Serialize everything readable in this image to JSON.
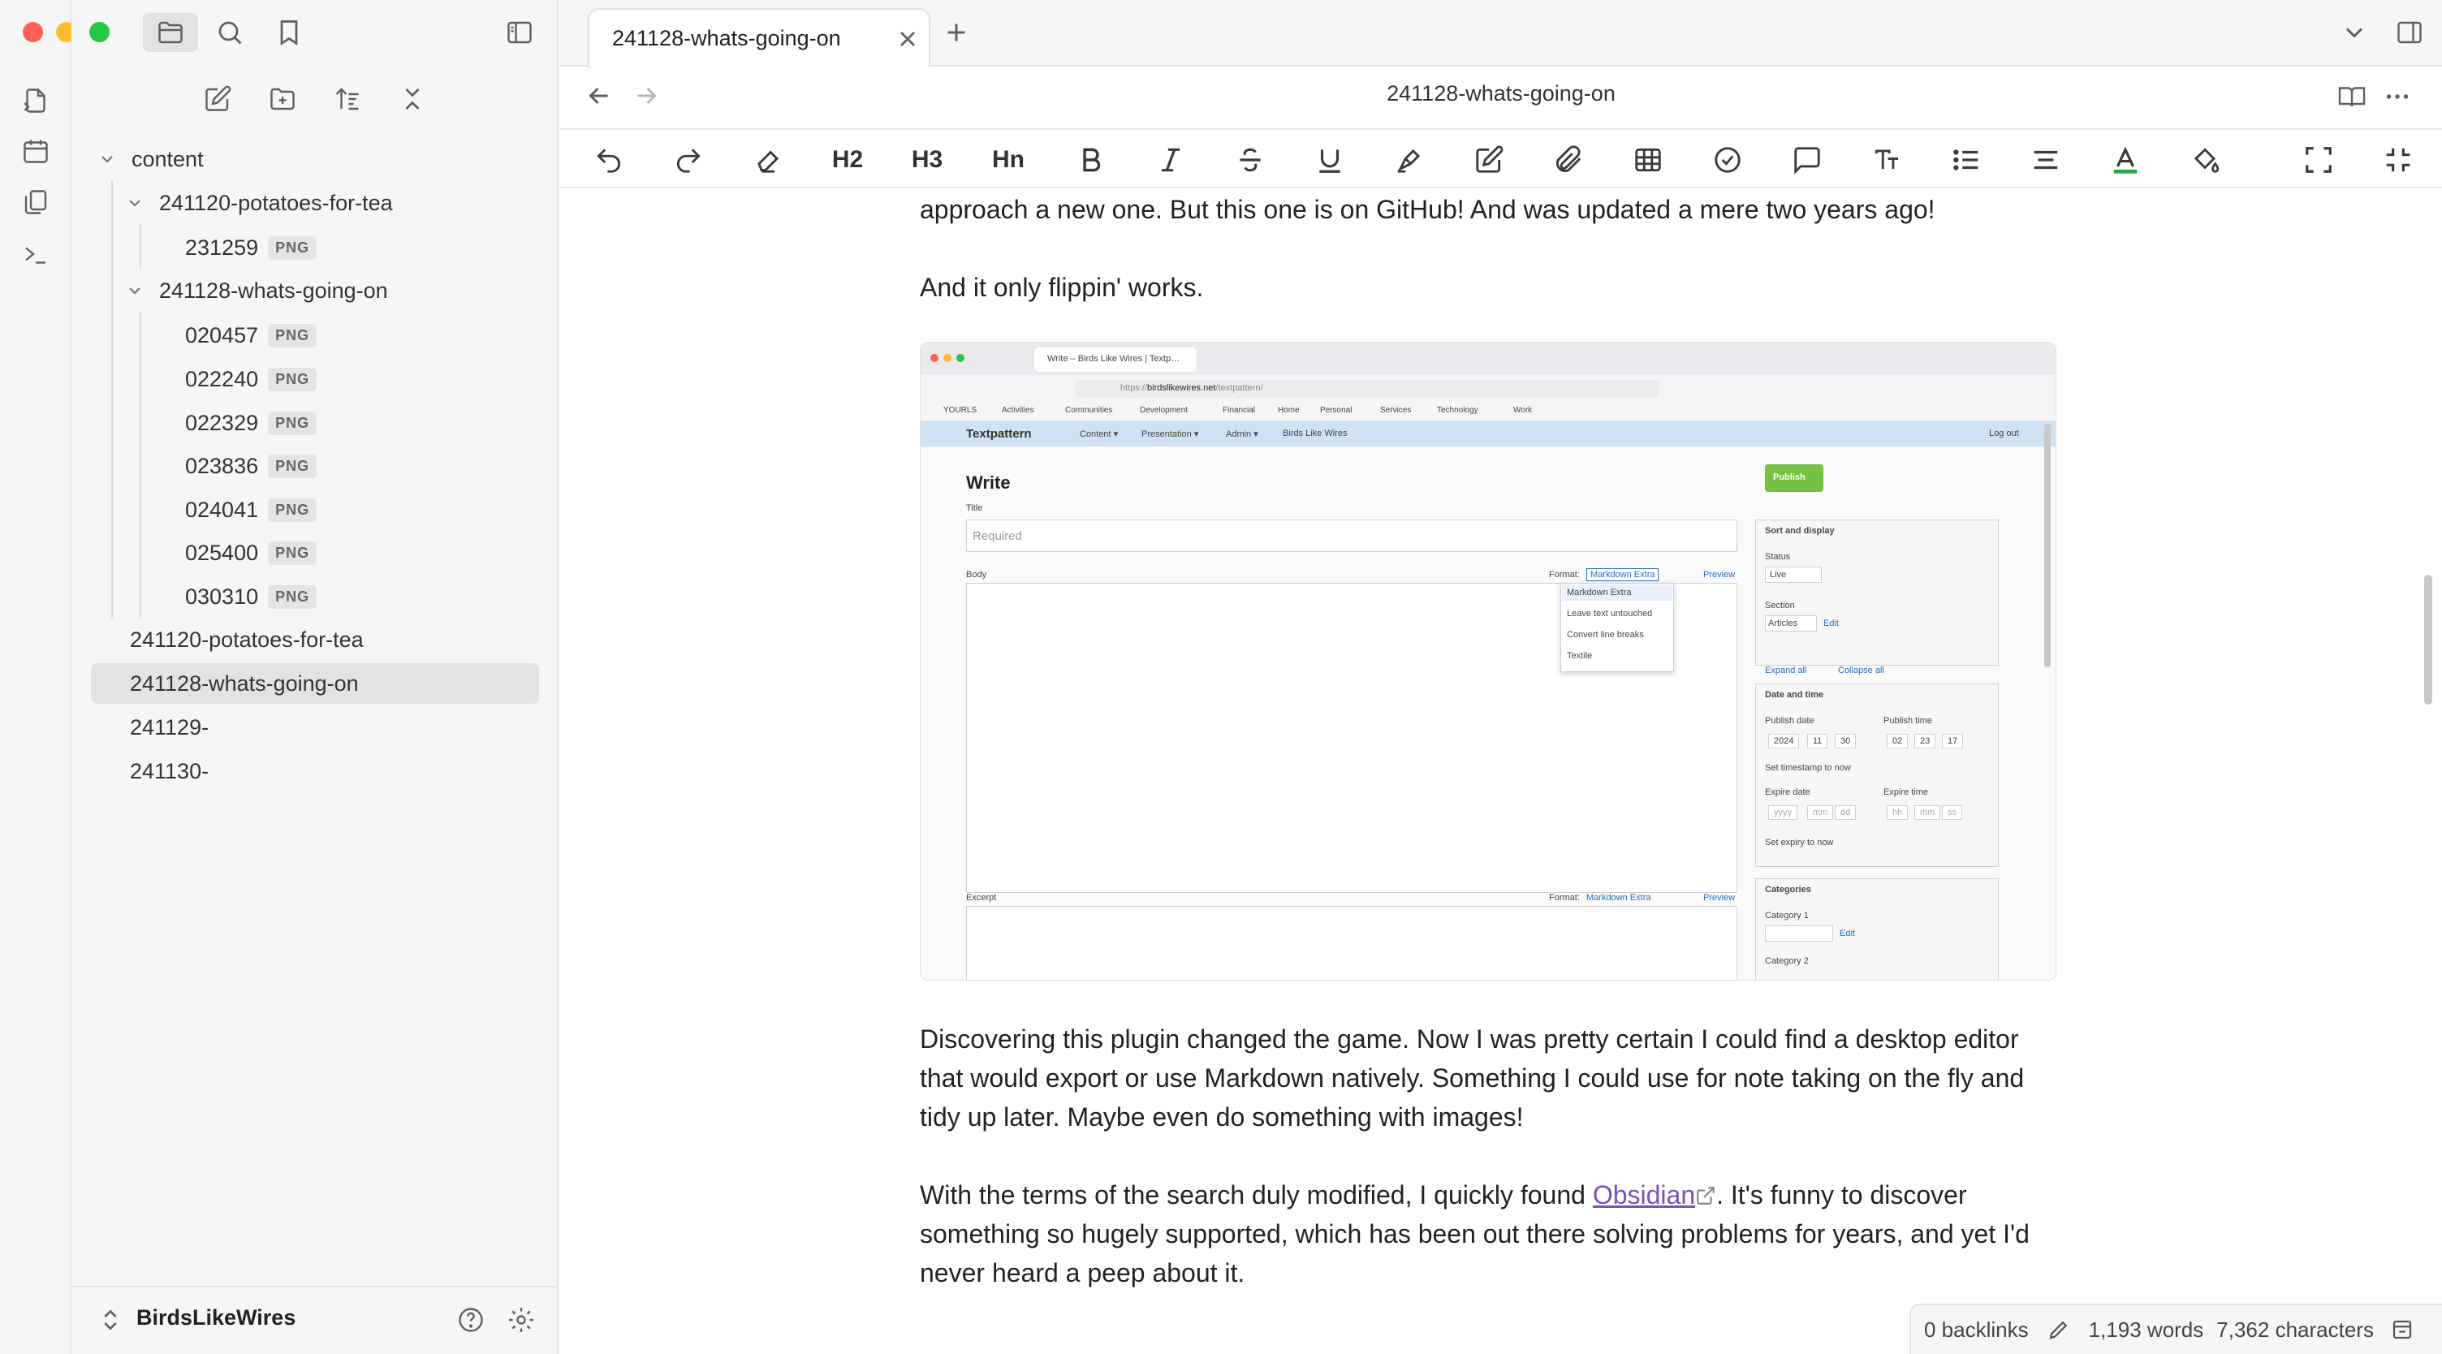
{
  "window": {
    "title": "241128-whats-going-on"
  },
  "colors": {
    "accent": "#7c4dbf",
    "close": "#ff5f57",
    "minimize": "#febc2e",
    "zoom": "#28c840",
    "publish_green": "#76c043",
    "textpattern_bar": "#cfe2f3"
  },
  "ribbon": {
    "icons": [
      "files-icon",
      "calendar-icon",
      "copy-icon",
      "terminal-icon"
    ]
  },
  "sidebar": {
    "top_icons": [
      "folder-icon",
      "search-icon",
      "bookmark-icon",
      "sidebar-toggle-icon"
    ],
    "actions": [
      "new-note-icon",
      "new-folder-icon",
      "sort-icon",
      "collapse-all-icon"
    ],
    "tree": {
      "root": "content",
      "folder1": {
        "name": "241120-potatoes-for-tea",
        "files": [
          {
            "name": "231259",
            "ext": "PNG"
          }
        ]
      },
      "folder2": {
        "name": "241128-whats-going-on",
        "files": [
          {
            "name": "020457",
            "ext": "PNG"
          },
          {
            "name": "022240",
            "ext": "PNG"
          },
          {
            "name": "022329",
            "ext": "PNG"
          },
          {
            "name": "023836",
            "ext": "PNG"
          },
          {
            "name": "024041",
            "ext": "PNG"
          },
          {
            "name": "025400",
            "ext": "PNG"
          },
          {
            "name": "030310",
            "ext": "PNG"
          }
        ]
      },
      "notes": [
        "241120-potatoes-for-tea",
        "241128-whats-going-on",
        "241129-",
        "241130-"
      ]
    },
    "vault": {
      "name": "BirdsLikeWires"
    }
  },
  "tabs": [
    {
      "label": "241128-whats-going-on",
      "active": true
    }
  ],
  "header": {
    "title": "241128-whats-going-on"
  },
  "toolbar": {
    "h2": "H2",
    "h3": "H3",
    "hn": "Hn",
    "items": [
      "undo-icon",
      "redo-icon",
      "eraser-icon",
      "h2",
      "h3",
      "hn",
      "bold-icon",
      "italic-icon",
      "strikethrough-icon",
      "underline-icon",
      "highlighter-icon",
      "edit-icon",
      "attachment-icon",
      "table-icon",
      "checkbox-icon",
      "comment-icon",
      "text-size-icon",
      "list-icon",
      "align-icon",
      "text-color-icon",
      "fill-icon",
      "fullscreen-icon",
      "exit-fullscreen-icon"
    ]
  },
  "editor": {
    "para_top": "approach a new one. But this one is on GitHub! And was updated a mere two years ago!",
    "para_works": "And it only flippin' works.",
    "para_discover": "Discovering this plugin changed the game. Now I was pretty certain I could find a desktop editor that would export or use Markdown natively. Something I could use for note taking on the fly and tidy up later. Maybe even do something with images!",
    "para_obsidian_before": "With the terms of the search duly modified, I quickly found ",
    "obsidian_link": "Obsidian",
    "para_obsidian_after": ". It's funny to discover something so hugely supported, which has been out there solving problems for years, and yet I'd never heard a peep about it."
  },
  "embedded": {
    "tab_title": "Write – Birds Like Wires | Textp…",
    "url_prefix": "https://",
    "url_domain": "birdslikewires.net",
    "url_path": "/textpattern/",
    "bookmarks": [
      "YOURLS",
      "Activities",
      "Communities",
      "Development",
      "Financial",
      "Home",
      "Personal",
      "Services",
      "Technology",
      "Work"
    ],
    "brand": "Textpattern",
    "nav": [
      "Content ▾",
      "Presentation ▾",
      "Admin ▾",
      "Birds Like Wires"
    ],
    "logout": "Log out",
    "heading": "Write",
    "title_label": "Title",
    "title_placeholder": "Required",
    "body_label": "Body",
    "format_label": "Format:",
    "format_value": "Markdown Extra",
    "preview": "Preview",
    "format_options": [
      "Markdown Extra",
      "Leave text untouched",
      "Convert line breaks",
      "Textile"
    ],
    "excerpt_label": "Excerpt",
    "publish": "Publish",
    "sort_display": "Sort and display",
    "status_label": "Status",
    "status_value": "Live",
    "section_label": "Section",
    "section_value": "Articles",
    "edit": "Edit",
    "expand_all": "Expand all",
    "collapse_all": "Collapse all",
    "date_time": "Date and time",
    "publish_date": "Publish date",
    "publish_time": "Publish time",
    "date_parts": [
      "2024",
      "11",
      "30"
    ],
    "time_parts": [
      "02",
      "23",
      "17"
    ],
    "set_timestamp": "Set timestamp to now",
    "expire_date": "Expire date",
    "expire_time": "Expire time",
    "expire_placeholders": [
      "yyyy",
      "mm",
      "dd"
    ],
    "expire_time_placeholders": [
      "hh",
      "mm",
      "ss"
    ],
    "set_expiry": "Set expiry to now",
    "categories": "Categories",
    "category1": "Category 1",
    "category2": "Category 2"
  },
  "status_bar": {
    "backlinks": "0 backlinks",
    "words": "1,193 words",
    "characters": "7,362 characters"
  }
}
